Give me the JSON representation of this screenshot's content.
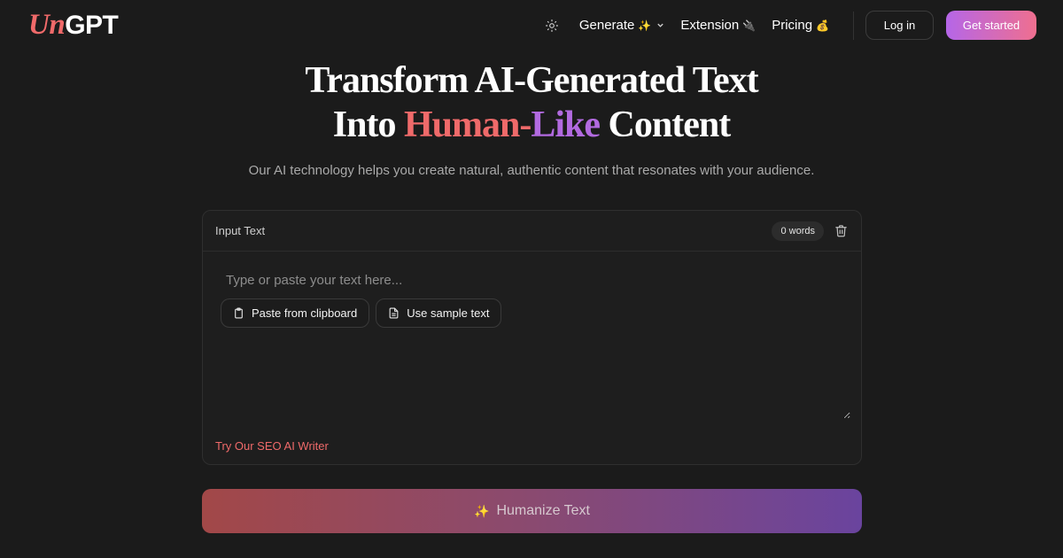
{
  "header": {
    "logo": {
      "part1": "Un",
      "part2": "GPT"
    },
    "nav": [
      {
        "label": "Generate",
        "emoji": "✨",
        "has_dropdown": true
      },
      {
        "label": "Extension",
        "emoji": "🔌",
        "has_dropdown": false
      },
      {
        "label": "Pricing",
        "emoji": "💰",
        "has_dropdown": false
      }
    ],
    "login_label": "Log in",
    "get_started_label": "Get started"
  },
  "hero": {
    "line1": "Transform AI-Generated Text",
    "line2_pre": "Into ",
    "line2_accent_a": "Human-",
    "line2_accent_b": "Like",
    "line2_post": " Content",
    "subtitle": "Our AI technology helps you create natural, authentic content that resonates with your audience."
  },
  "input_card": {
    "title": "Input Text",
    "word_count": "0 words",
    "placeholder": "Type or paste your text here...",
    "value": "",
    "paste_label": "Paste from clipboard",
    "sample_label": "Use sample text",
    "seo_link": "Try Our SEO AI Writer"
  },
  "humanize": {
    "icon": "✨",
    "label": "Humanize Text"
  },
  "colors": {
    "background": "#1b1b1b",
    "accent_red": "#ef6a6a",
    "accent_purple": "#b26ae0"
  },
  "icons": {
    "theme": "sun-icon",
    "dropdown": "chevron-down-icon",
    "trash": "trash-icon",
    "clipboard": "clipboard-icon",
    "document": "document-icon"
  }
}
